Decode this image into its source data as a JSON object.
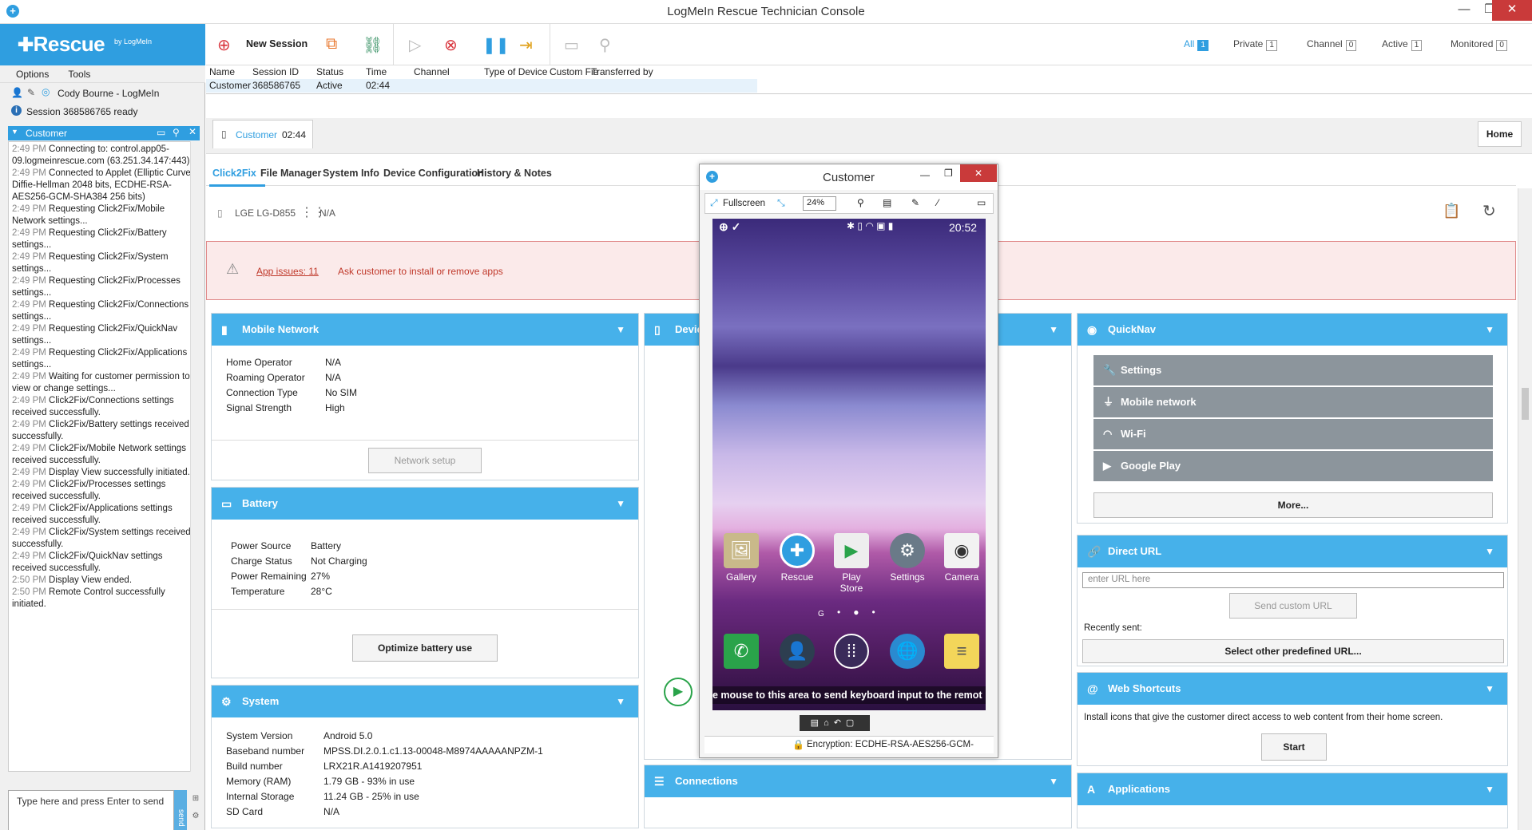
{
  "window": {
    "title": "LogMeIn Rescue Technician Console"
  },
  "logo": {
    "name": "Rescue",
    "by": "by LogMeIn"
  },
  "menu": [
    "Options",
    "Tools"
  ],
  "technician": {
    "name": "Cody Bourne - LogMeIn"
  },
  "session_status": "Session 368586765 ready",
  "sidebar": {
    "customer_label": "Customer",
    "log": [
      {
        "time": "2:49 PM",
        "text": "Connecting to: control.app05-09.logmeinrescue.com (63.251.34.147:443)"
      },
      {
        "time": "2:49 PM",
        "text": "Connected to Applet (Elliptic Curve Diffie-Hellman 2048 bits, ECDHE-RSA-AES256-GCM-SHA384 256 bits)"
      },
      {
        "time": "2:49 PM",
        "text": "Requesting Click2Fix/Mobile Network settings..."
      },
      {
        "time": "2:49 PM",
        "text": "Requesting Click2Fix/Battery settings..."
      },
      {
        "time": "2:49 PM",
        "text": "Requesting Click2Fix/System settings..."
      },
      {
        "time": "2:49 PM",
        "text": "Requesting Click2Fix/Processes settings..."
      },
      {
        "time": "2:49 PM",
        "text": "Requesting Click2Fix/Connections settings..."
      },
      {
        "time": "2:49 PM",
        "text": "Requesting Click2Fix/QuickNav settings..."
      },
      {
        "time": "2:49 PM",
        "text": "Requesting Click2Fix/Applications settings..."
      },
      {
        "time": "2:49 PM",
        "text": "Waiting for customer permission to view or change settings..."
      },
      {
        "time": "2:49 PM",
        "text": "Click2Fix/Connections settings received successfully."
      },
      {
        "time": "2:49 PM",
        "text": "Click2Fix/Battery settings received successfully."
      },
      {
        "time": "2:49 PM",
        "text": "Click2Fix/Mobile Network settings received successfully."
      },
      {
        "time": "2:49 PM",
        "text": "Display View successfully initiated."
      },
      {
        "time": "2:49 PM",
        "text": "Click2Fix/Processes settings received successfully."
      },
      {
        "time": "2:49 PM",
        "text": "Click2Fix/Applications settings received successfully."
      },
      {
        "time": "2:49 PM",
        "text": "Click2Fix/System settings received successfully."
      },
      {
        "time": "2:49 PM",
        "text": "Click2Fix/QuickNav settings received successfully."
      },
      {
        "time": "2:50 PM",
        "text": "Display View ended."
      },
      {
        "time": "2:50 PM",
        "text": "Remote Control successfully initiated."
      }
    ],
    "chat_placeholder": "Type here and press Enter to send",
    "send_label": "send"
  },
  "toolbar": {
    "new_session": "New Session",
    "filters": [
      {
        "label": "All",
        "count": "1"
      },
      {
        "label": "Private",
        "count": "1"
      },
      {
        "label": "Channel",
        "count": "0"
      },
      {
        "label": "Active",
        "count": "1"
      },
      {
        "label": "Monitored",
        "count": "0"
      }
    ]
  },
  "sessions": {
    "headers": [
      "Name",
      "Session ID",
      "Status",
      "Time",
      "Channel",
      "Type of Device",
      "Custom Fie",
      "Transferred by"
    ],
    "rows": [
      [
        "Customer",
        "368586765",
        "Active",
        "02:44",
        "",
        "",
        "",
        ""
      ]
    ]
  },
  "tab": {
    "label": "Customer",
    "time": "02:44",
    "home": "Home"
  },
  "subtabs": [
    "Click2Fix",
    "File Manager",
    "System Info",
    "Device Configuration",
    "History & Notes"
  ],
  "device": {
    "model": "LGE LG-D855",
    "value": "N/A"
  },
  "alert": {
    "link": "App issues: 11",
    "text": "Ask customer to install or remove apps"
  },
  "mobile_network": {
    "title": "Mobile Network",
    "rows": [
      [
        "Home Operator",
        "N/A"
      ],
      [
        "Roaming Operator",
        "N/A"
      ],
      [
        "Connection Type",
        "No SIM"
      ],
      [
        "Signal Strength",
        "High"
      ]
    ],
    "button": "Network setup"
  },
  "battery": {
    "title": "Battery",
    "rows": [
      [
        "Power Source",
        "Battery"
      ],
      [
        "Charge Status",
        "Not Charging"
      ],
      [
        "Power Remaining",
        "27%"
      ],
      [
        "Temperature",
        "28°C"
      ]
    ],
    "button": "Optimize battery use"
  },
  "system": {
    "title": "System",
    "rows": [
      [
        "System Version",
        "Android 5.0"
      ],
      [
        "Baseband number",
        "MPSS.DI.2.0.1.c1.13-00048-M8974AAAAANPZM-1"
      ],
      [
        "Build number",
        "LRX21R.A1419207951"
      ],
      [
        "Memory (RAM)",
        "1.79 GB - 93% in use"
      ],
      [
        "Internal Storage",
        "11.24 GB - 25% in use"
      ],
      [
        "SD Card",
        "N/A"
      ]
    ]
  },
  "device_panel": {
    "title": "Devic"
  },
  "connections": {
    "title": "Connections"
  },
  "quicknav": {
    "title": "QuickNav",
    "items": [
      "Settings",
      "Mobile network",
      "Wi-Fi",
      "Google Play"
    ],
    "more": "More..."
  },
  "direct_url": {
    "title": "Direct URL",
    "placeholder": "enter URL here",
    "button": "Send custom URL",
    "recent": "Recently sent:",
    "predefined": "Select other predefined URL..."
  },
  "web_shortcuts": {
    "title": "Web Shortcuts",
    "desc": "Install icons that give the customer direct access to web content from their home screen.",
    "button": "Start"
  },
  "applications": {
    "title": "Applications"
  },
  "popup": {
    "title": "Customer",
    "fullscreen": "Fullscreen",
    "zoom": "24%",
    "clock": "20:52",
    "apps": [
      "Gallery",
      "Rescue",
      "Play Store",
      "Settings",
      "Camera"
    ],
    "google_letter": "G",
    "keyboard_hint": "e mouse to this area to send keyboard input to the remot",
    "encryption": "Encryption: ECDHE-RSA-AES256-GCM-"
  }
}
